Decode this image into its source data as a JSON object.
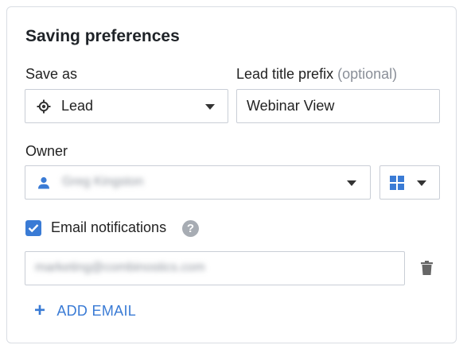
{
  "panel": {
    "title": "Saving preferences"
  },
  "save_as": {
    "label": "Save as",
    "value": "Lead",
    "icon": "target-icon"
  },
  "lead_title_prefix": {
    "label": "Lead title prefix",
    "optional": "(optional)",
    "value": "Webinar View"
  },
  "owner": {
    "label": "Owner",
    "value": "Greg Kingston",
    "icon": "person-icon"
  },
  "view_toggle": {
    "icon": "grid-icon"
  },
  "email_notifications": {
    "label": "Email notifications",
    "checked": true,
    "help": "?"
  },
  "emails": [
    {
      "value": "marketing@combinostics.com"
    }
  ],
  "add_email": {
    "label": "ADD EMAIL"
  },
  "colors": {
    "accent": "#3a7bd5",
    "border": "#c9ced6"
  }
}
